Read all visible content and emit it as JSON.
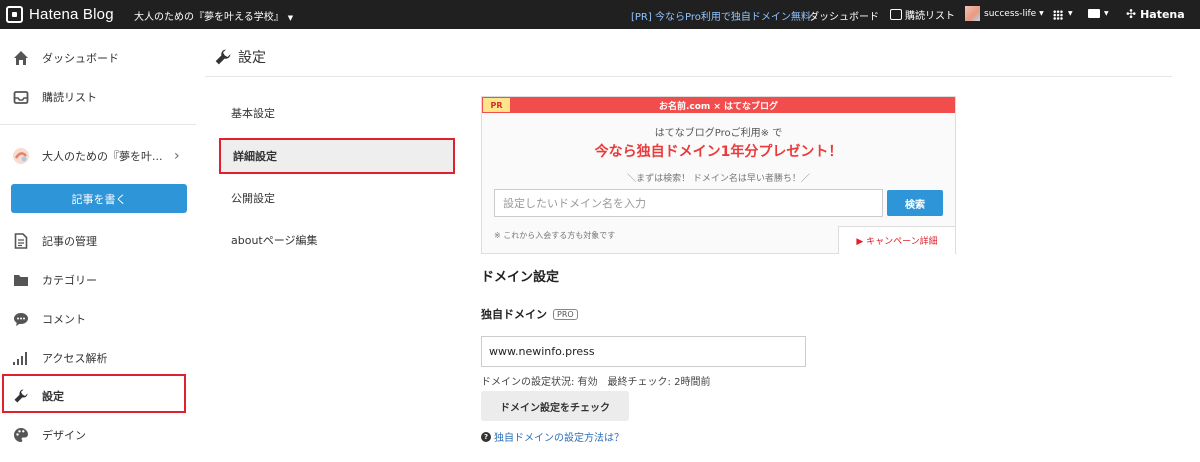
{
  "topbar": {
    "logo_text": "Hatena Blog",
    "blog_name": "大人のための『夢を叶える学校』",
    "promo": "[PR] 今ならPro利用で独自ドメイン無料",
    "dashboard": "ダッシュボード",
    "reading_list": "購読リスト",
    "username": "success-life",
    "hatena": "Hatena"
  },
  "sidebar": {
    "items": [
      {
        "label": "ダッシュボード",
        "icon": "home-icon"
      },
      {
        "label": "購読リスト",
        "icon": "inbox-icon"
      },
      {
        "label": "大人のための『夢を叶...",
        "icon": "blog-avatar-icon"
      },
      {
        "label": "記事の管理",
        "icon": "document-icon"
      },
      {
        "label": "カテゴリー",
        "icon": "folder-icon"
      },
      {
        "label": "コメント",
        "icon": "comment-icon"
      },
      {
        "label": "アクセス解析",
        "icon": "bar-chart-icon"
      },
      {
        "label": "設定",
        "icon": "wrench-icon"
      },
      {
        "label": "デザイン",
        "icon": "palette-icon"
      }
    ],
    "write_button": "記事を書く",
    "active_item": "設定"
  },
  "page": {
    "title": "設定",
    "subnav": [
      "基本設定",
      "詳細設定",
      "公開設定",
      "aboutページ編集"
    ],
    "active_subnav": "詳細設定"
  },
  "promo_box": {
    "tag": "PR",
    "banner": "お名前.com × はてなブログ",
    "line1": "はてなブログProご利用※ で",
    "headline": "今なら独自ドメイン1年分プレゼント！",
    "line3": "＼まずは検索！ ドメイン名は早い者勝ち！／",
    "input_placeholder": "設定したいドメイン名を入力",
    "search_button": "検索",
    "note": "※ これから入会する方も対象です",
    "campaign_link": "▶ キャンペーン詳細"
  },
  "domain": {
    "section_title": "ドメイン設定",
    "field_label": "独自ドメイン",
    "pro_badge": "PRO",
    "value": "www.newinfo.press",
    "status": "ドメインの設定状況: 有効　最終チェック: 2時間前",
    "check_button": "ドメイン設定をチェック",
    "help_link": "独自ドメインの設定方法は？"
  },
  "colors": {
    "accent_blue": "#2d95d8",
    "highlight_red": "#e0202c",
    "topbar": "#202020"
  }
}
